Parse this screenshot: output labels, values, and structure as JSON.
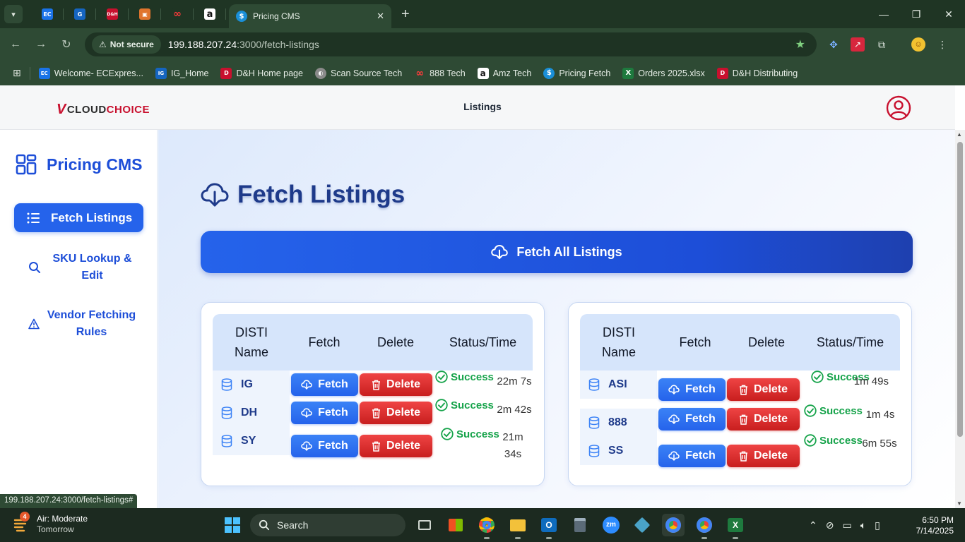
{
  "browser": {
    "active_tab_title": "Pricing CMS",
    "security_label": "Not secure",
    "url_host": "199.188.207.24",
    "url_path": ":3000/fetch-listings",
    "status_url": "199.188.207.24:3000/fetch-listings#",
    "pinned_tabs": [
      {
        "icon": "ec-icon",
        "text": "EC",
        "color": "#1a73e8"
      },
      {
        "icon": "g-icon",
        "text": "G",
        "color": "#1565c0"
      },
      {
        "icon": "dh-icon",
        "text": "D&H",
        "color": "#c8102e"
      },
      {
        "icon": "box-icon",
        "text": "▣",
        "color": "#e0752d"
      },
      {
        "icon": "888-icon",
        "text": "∞",
        "color": "#d11f1f"
      },
      {
        "icon": "amazon-icon",
        "text": "a",
        "color": "#111111"
      }
    ],
    "bookmarks": [
      {
        "label": "Welcome- ECExpres...",
        "text": "EC",
        "color": "#1a73e8"
      },
      {
        "label": "IG_Home",
        "text": "IG",
        "color": "#1565c0"
      },
      {
        "label": "D&H Home page",
        "text": "D",
        "color": "#c8102e"
      },
      {
        "label": "Scan Source Tech",
        "text": "◐",
        "color": "#8a8a8a"
      },
      {
        "label": "888 Tech",
        "text": "∞",
        "color": "#d11f1f"
      },
      {
        "label": "Amz Tech",
        "text": "a",
        "color": "#111111"
      },
      {
        "label": "Pricing Fetch",
        "text": "$",
        "color": "#1a8fd8"
      },
      {
        "label": "Orders 2025.xlsx",
        "text": "X",
        "color": "#1e7a3e"
      },
      {
        "label": "D&H Distributing",
        "text": "D",
        "color": "#c8102e"
      }
    ]
  },
  "header": {
    "logo_v": "V",
    "logo_cloud": "CLOUD",
    "logo_choice": "CHOICE",
    "nav_label": "Listings"
  },
  "sidebar": {
    "brand": "Pricing CMS",
    "items": [
      {
        "label": "Fetch Listings",
        "icon": "list-icon"
      },
      {
        "label": "SKU Lookup & Edit",
        "icon": "search-icon"
      },
      {
        "label": "Vendor Fetching Rules",
        "icon": "warning-icon"
      }
    ]
  },
  "main": {
    "title": "Fetch Listings",
    "fetch_all_label": "Fetch All Listings",
    "columns": [
      "DISTI Name",
      "Fetch",
      "Delete",
      "Status/Time"
    ],
    "fetch_label": "Fetch",
    "delete_label": "Delete",
    "left_table": [
      {
        "name": "IG",
        "status": "Success",
        "time": "22m 7s"
      },
      {
        "name": "DH",
        "status": "Success",
        "time": "2m 42s"
      },
      {
        "name": "SY",
        "status": "Success",
        "time": "21m 34s"
      }
    ],
    "right_table": [
      {
        "name": "ASI",
        "status": "Success",
        "time": "1m 49s"
      },
      {
        "name": "888",
        "status": "Success",
        "time": "1m 4s"
      },
      {
        "name": "SS",
        "status": "Success",
        "time": "6m 55s"
      }
    ]
  },
  "taskbar": {
    "weather_badge": "4",
    "weather_title": "Air: Moderate",
    "weather_sub": "Tomorrow",
    "search_label": "Search",
    "zoom_label": "zm",
    "time": "6:50 PM",
    "date": "7/14/2025"
  },
  "colors": {
    "primary": "#2563eb",
    "danger": "#dc2626",
    "success": "#16a34a",
    "title": "#1e3a8a"
  }
}
